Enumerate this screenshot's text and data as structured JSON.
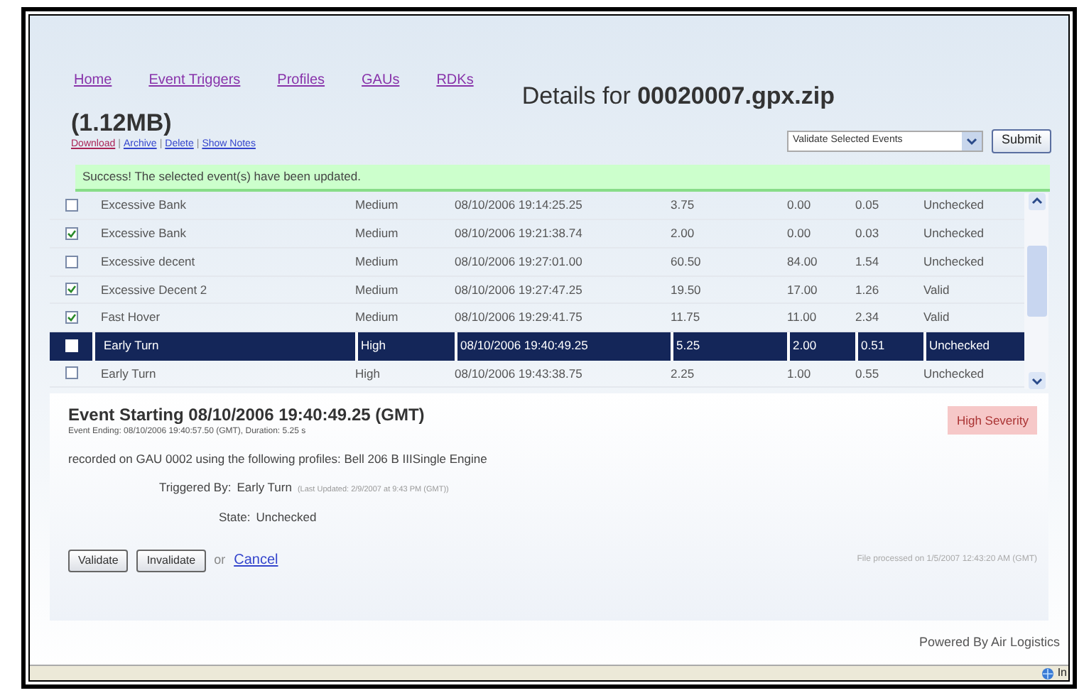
{
  "nav": [
    "Home",
    "Event Triggers",
    "Profiles",
    "GAUs",
    "RDKs"
  ],
  "details_title": {
    "prefix": "Details for ",
    "file": "00020007.gpx.zip"
  },
  "file_size": "(1.12MB)",
  "file_links": [
    {
      "kind": "link",
      "text": "Download"
    },
    {
      "kind": "separator",
      "text": "|"
    },
    {
      "kind": "link",
      "text": "Archive"
    },
    {
      "kind": "separator",
      "text": "|"
    },
    {
      "kind": "link",
      "text": "Delete"
    },
    {
      "kind": "separator",
      "text": "|"
    },
    {
      "kind": "link",
      "text": "Show Notes"
    }
  ],
  "action_select": {
    "value": "Validate Selected Events"
  },
  "submit_button": "Submit",
  "message": "Success! The selected event(s) have been updated.",
  "events": [
    {
      "checked": false,
      "selected": false,
      "name": "Excessive Bank",
      "severity": "Medium",
      "time": "08/10/2006 19:14:25.25",
      "column_4": "3.75",
      "column_5": "0.00",
      "column_6": "0.05",
      "state": "Unchecked"
    },
    {
      "checked": true,
      "selected": false,
      "name": "Excessive Bank",
      "severity": "Medium",
      "time": "08/10/2006 19:21:38.74",
      "column_4": "2.00",
      "column_5": "0.00",
      "column_6": "0.03",
      "state": "Unchecked"
    },
    {
      "checked": false,
      "selected": false,
      "name": "Excessive decent",
      "severity": "Medium",
      "time": "08/10/2006 19:27:01.00",
      "column_4": "60.50",
      "column_5": "84.00",
      "column_6": "1.54",
      "state": "Unchecked"
    },
    {
      "checked": true,
      "selected": false,
      "name": "Excessive Decent 2",
      "severity": "Medium",
      "time": "08/10/2006 19:27:47.25",
      "column_4": "19.50",
      "column_5": "17.00",
      "column_6": "1.26",
      "state": "Valid"
    },
    {
      "checked": true,
      "selected": false,
      "name": "Fast Hover",
      "severity": "Medium",
      "time": "08/10/2006 19:29:41.75",
      "column_4": "11.75",
      "column_5": "11.00",
      "column_6": "2.34",
      "state": "Valid"
    },
    {
      "checked": false,
      "selected": true,
      "name": "Early Turn",
      "severity": "High",
      "time": "08/10/2006 19:40:49.25",
      "column_4": "5.25",
      "column_5": "2.00",
      "column_6": "0.51",
      "state": "Unchecked"
    },
    {
      "checked": false,
      "selected": false,
      "name": "Early Turn",
      "severity": "High",
      "time": "08/10/2006 19:43:38.75",
      "column_4": "2.25",
      "column_5": "1.00",
      "column_6": "0.55",
      "state": "Unchecked"
    }
  ],
  "event_detail": {
    "title": "Event Starting 08/10/2006 19:40:49.25 (GMT)",
    "subtitle": "Event Ending: 08/10/2006 19:40:57.50 (GMT), Duration: 5.25 s",
    "severity_badge": "High Severity",
    "recorded": "recorded on GAU 0002 using the following profiles: Bell 206 B IIISingle Engine",
    "triggered_label": "Triggered By:",
    "triggered_value": "Early Turn",
    "last_updated": "(Last Updated: 2/9/2007 at 9:43 PM (GMT))",
    "state_label": "State:",
    "state_value": "Unchecked",
    "buttons": [
      "Validate",
      "Invalidate"
    ],
    "or": "or",
    "cancel": "Cancel",
    "processed": "File processed on 1/5/2007 12:43:20 AM (GMT)"
  },
  "footer": "Powered By Air Logistics",
  "status_bar": {
    "text": "In"
  }
}
